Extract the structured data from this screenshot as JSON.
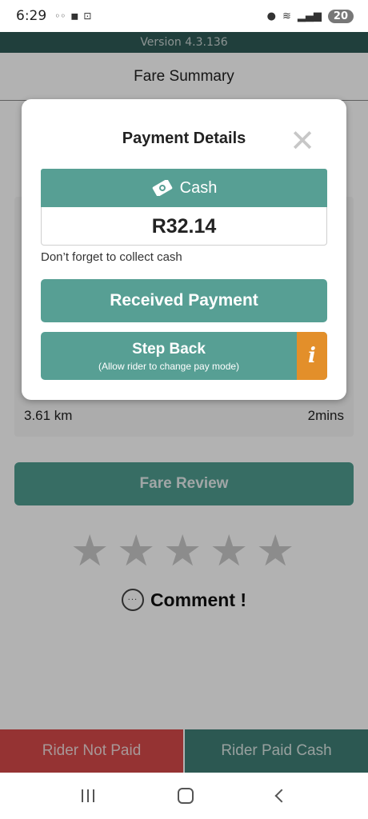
{
  "status_bar": {
    "time": "6:29",
    "battery": "20",
    "icons": [
      "wifi-calling-icon",
      "teams-icon",
      "screenshot-icon",
      "location-icon",
      "wifi-icon",
      "signal-icon"
    ]
  },
  "app": {
    "version": "Version 4.3.136",
    "header_title": "Fare Summary"
  },
  "trip": {
    "distance": "3.61 km",
    "duration": "2mins"
  },
  "fare_review_label": "Fare Review",
  "rating": {
    "max_stars": 5,
    "selected": 0
  },
  "comment_label": "Comment !",
  "bottom_buttons": {
    "not_paid": "Rider Not Paid",
    "paid_cash": "Rider Paid Cash"
  },
  "modal": {
    "title": "Payment Details",
    "payment_method": "Cash",
    "amount": "R32.14",
    "note": "Don’t forget to collect cash",
    "received_button": "Received Payment",
    "step_back_label": "Step Back",
    "step_back_sub": "(Allow rider to change pay mode)",
    "info_glyph": "i"
  },
  "colors": {
    "teal": "#579f94",
    "dark_teal": "#2f5b57",
    "red": "#d64a4a",
    "orange": "#e38f2a"
  }
}
